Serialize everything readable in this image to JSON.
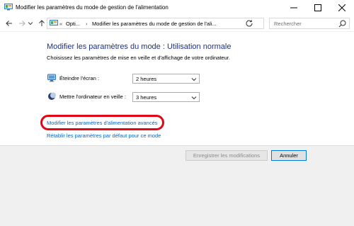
{
  "window": {
    "title": "Modifier les paramètres du mode de gestion de l'alimentation"
  },
  "address_bar": {
    "prefix": "«",
    "crumbs": [
      "Opti...",
      "Modifier les paramètres du mode de gestion de l'ali..."
    ]
  },
  "search": {
    "placeholder": "Rechercher"
  },
  "main": {
    "heading": "Modifier les paramètres du mode : Utilisation normale",
    "subheading": "Choisissez les paramètres de mise en veille et d'affichage de votre ordinateur.",
    "settings": [
      {
        "label": "Éteindre l'écran :",
        "value": "2 heures",
        "icon": "monitor-icon"
      },
      {
        "label": "Mettre l'ordinateur en veille :",
        "value": "3 heures",
        "icon": "moon-icon"
      }
    ],
    "links": {
      "advanced": "Modifier les paramètres d'alimentation avancés",
      "restore": "Rétablir les paramètres par défaut pour ce mode"
    }
  },
  "footer": {
    "save_label": "Enregistrer les modifications",
    "cancel_label": "Annuler"
  },
  "colors": {
    "heading": "#1e3287",
    "link": "#0066cc",
    "highlight": "#e30613"
  }
}
